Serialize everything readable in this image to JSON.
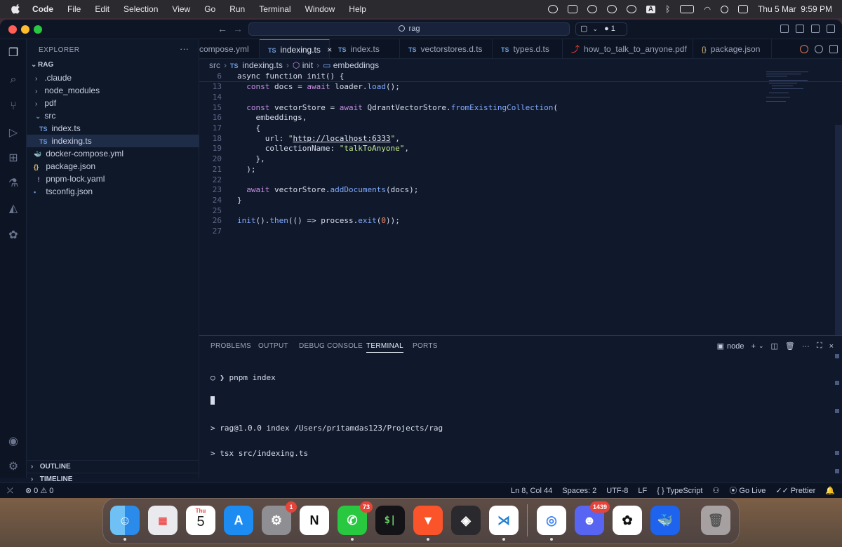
{
  "menubar": {
    "app": "Code",
    "items": [
      "File",
      "Edit",
      "Selection",
      "View",
      "Go",
      "Run",
      "Terminal",
      "Window",
      "Help"
    ],
    "input_indicator": "A",
    "datetime": "Thu 5 Mar  9:59 PM"
  },
  "titlebar": {
    "search_text": "rag",
    "chat_badge": "1"
  },
  "explorer": {
    "title": "EXPLORER",
    "root": "RAG",
    "items": [
      {
        "label": ".claude",
        "type": "folder"
      },
      {
        "label": "node_modules",
        "type": "folder"
      },
      {
        "label": "pdf",
        "type": "folder"
      },
      {
        "label": "src",
        "type": "folder-open"
      },
      {
        "label": "index.ts",
        "type": "ts",
        "icon": "TS"
      },
      {
        "label": "indexing.ts",
        "type": "ts",
        "icon": "TS"
      },
      {
        "label": "docker-compose.yml",
        "type": "docker"
      },
      {
        "label": "package.json",
        "type": "json",
        "icon": "{}"
      },
      {
        "label": "pnpm-lock.yaml",
        "type": "yaml",
        "icon": "!"
      },
      {
        "label": "tsconfig.json",
        "type": "json"
      }
    ],
    "outline": "OUTLINE",
    "timeline": "TIMELINE"
  },
  "tabs": [
    {
      "label": "compose.yml",
      "icon": ""
    },
    {
      "label": "indexing.ts",
      "icon": "TS",
      "active": true
    },
    {
      "label": "index.ts",
      "icon": "TS"
    },
    {
      "label": "vectorstores.d.ts",
      "icon": "TS"
    },
    {
      "label": "types.d.ts",
      "icon": "TS"
    },
    {
      "label": "how_to_talk_to_anyone.pdf",
      "icon": "pdf"
    },
    {
      "label": "package.json",
      "icon": "{}"
    }
  ],
  "breadcrumb": {
    "folder": "src",
    "file_icon": "TS",
    "file": "indexing.ts",
    "func": "init",
    "symbol": "embeddings"
  },
  "editor": {
    "sticky_line_no": "6",
    "sticky_line": "async function init() {",
    "lines": [
      {
        "no": "13",
        "text": "  const docs = await loader.load();"
      },
      {
        "no": "14",
        "text": ""
      },
      {
        "no": "15",
        "text": "  const vectorStore = await QdrantVectorStore.fromExistingCollection("
      },
      {
        "no": "16",
        "text": "    embeddings,"
      },
      {
        "no": "17",
        "text": "    {"
      },
      {
        "no": "18",
        "text": "      url: \"http://localhost:6333\","
      },
      {
        "no": "19",
        "text": "      collectionName: \"talkToAnyone\","
      },
      {
        "no": "20",
        "text": "    },"
      },
      {
        "no": "21",
        "text": "  );"
      },
      {
        "no": "22",
        "text": ""
      },
      {
        "no": "23",
        "text": "  await vectorStore.addDocuments(docs);"
      },
      {
        "no": "24",
        "text": "}"
      },
      {
        "no": "25",
        "text": ""
      },
      {
        "no": "26",
        "text": "init().then(() => process.exit(0));"
      },
      {
        "no": "27",
        "text": ""
      }
    ]
  },
  "panel": {
    "tabs": [
      "PROBLEMS",
      "OUTPUT",
      "DEBUG CONSOLE",
      "TERMINAL",
      "PORTS"
    ],
    "active_tab": "TERMINAL",
    "shell": "node",
    "terminal_lines": [
      "○ ❯ pnpm index",
      "",
      "> rag@1.0.0 index /Users/pritamdas123/Projects/rag",
      "> tsx src/indexing.ts"
    ]
  },
  "statusbar": {
    "errors": "0",
    "warnings": "0",
    "position": "Ln 8, Col 44",
    "spaces": "Spaces: 2",
    "encoding": "UTF-8",
    "eol": "LF",
    "language": "TypeScript",
    "golive": "Go Live",
    "prettier": "Prettier"
  },
  "dock": {
    "calendar_month": "Thu",
    "calendar_day": "5",
    "settings_badge": "1",
    "whatsapp_badge": "73",
    "discord_badge": "1439",
    "terminal_glyph": "$|"
  }
}
